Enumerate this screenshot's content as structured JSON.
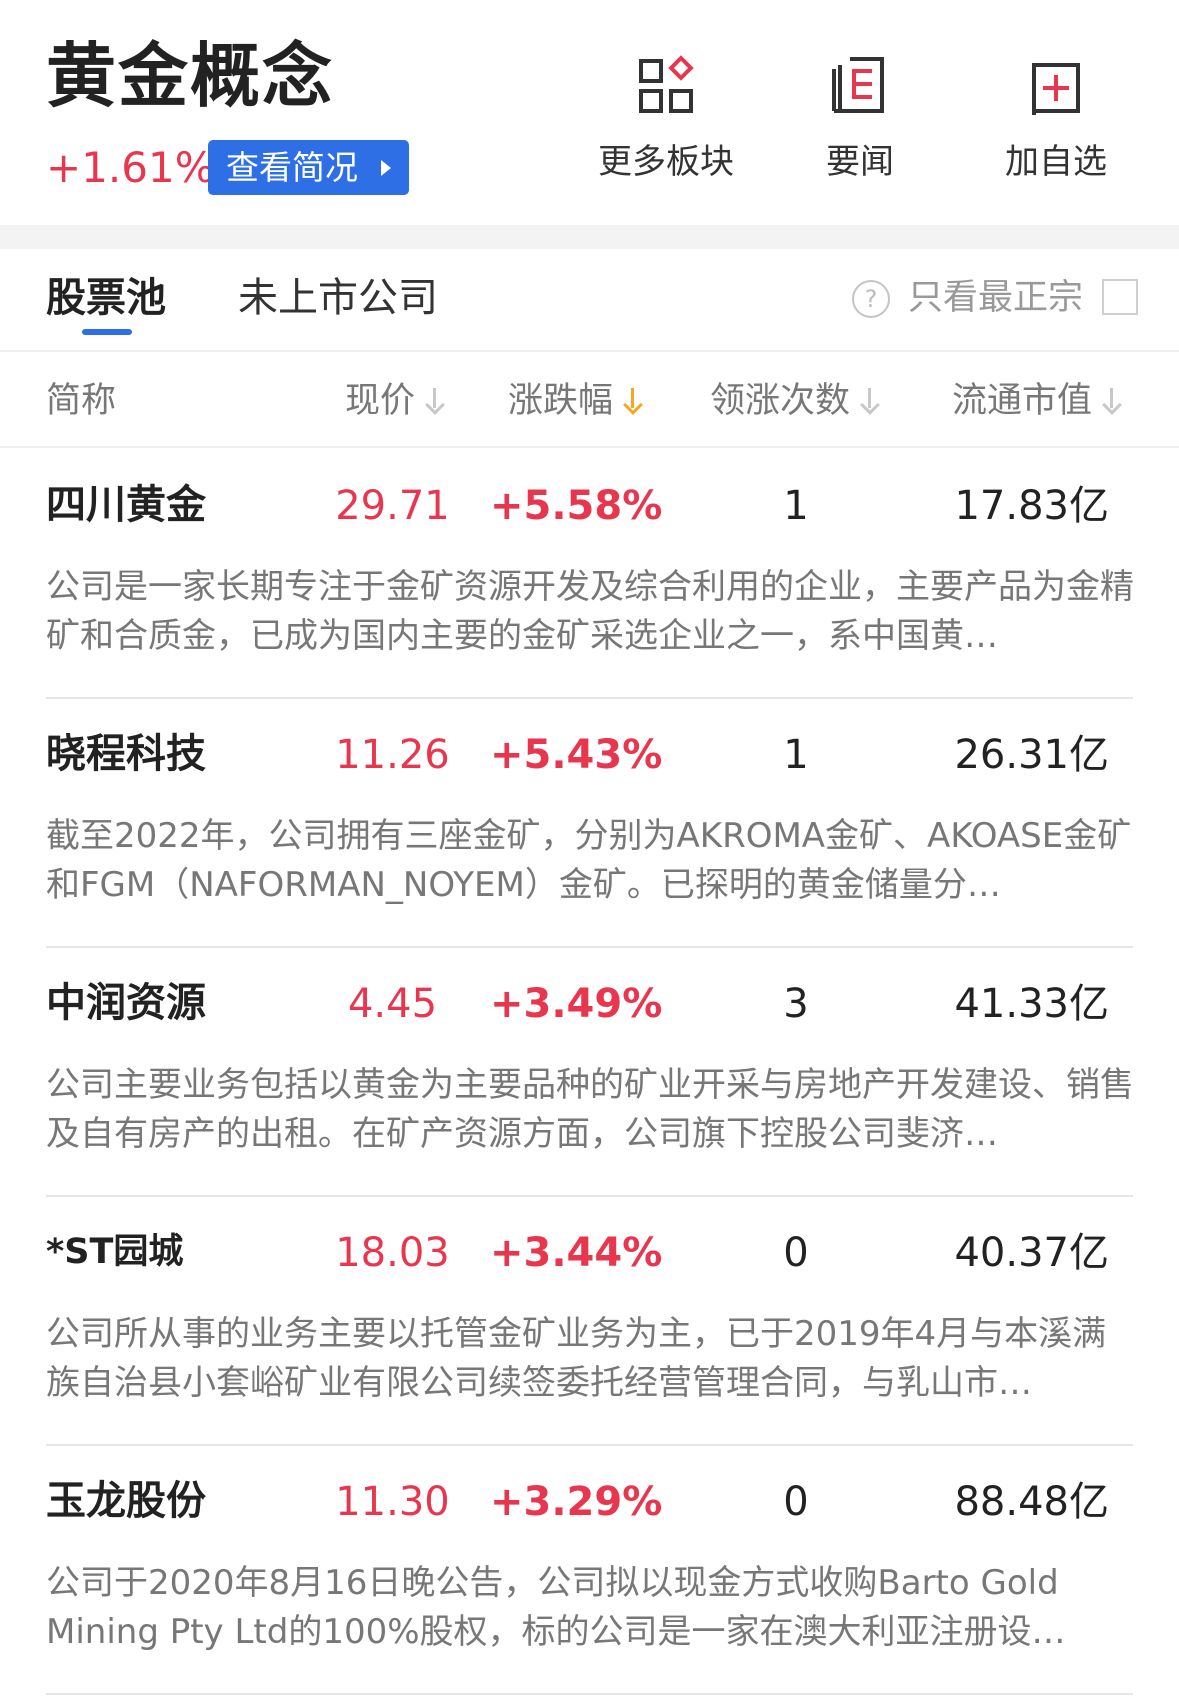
{
  "header": {
    "sector_name": "黄金概念",
    "sector_change": "+1.61%",
    "overview_button": "查看简况",
    "actions": [
      {
        "label": "更多板块",
        "icon": "grid-icon"
      },
      {
        "label": "要闻",
        "icon": "news-icon"
      },
      {
        "label": "加自选",
        "icon": "add-watchlist-icon"
      }
    ]
  },
  "tabs": {
    "stock_pool": "股票池",
    "unlisted": "未上市公司",
    "filter_label": "只看最正宗",
    "help_symbol": "?"
  },
  "columns": {
    "name": "简称",
    "price": "现价",
    "change": "涨跌幅",
    "lead_count": "领涨次数",
    "market_cap": "流通市值",
    "sorted_by": "涨跌幅"
  },
  "colors": {
    "up_red": "#e8364e",
    "accent_blue": "#2f6fe6",
    "sort_orange": "#f5a623"
  },
  "rows": [
    {
      "name": "四川黄金",
      "price": "29.71",
      "change": "+5.58%",
      "lead_count": "1",
      "market_cap": "17.83亿",
      "desc": "公司是一家长期专注于金矿资源开发及综合利用的企业，主要产品为金精矿和合质金，已成为国内主要的金矿采选企业之一，系中国黄…"
    },
    {
      "name": "晓程科技",
      "price": "11.26",
      "change": "+5.43%",
      "lead_count": "1",
      "market_cap": "26.31亿",
      "desc": "截至2022年，公司拥有三座金矿，分别为AKROMA金矿、AKOASE金矿和FGM（NAFORMAN_NOYEM）金矿。已探明的黄金储量分…"
    },
    {
      "name": "中润资源",
      "price": "4.45",
      "change": "+3.49%",
      "lead_count": "3",
      "market_cap": "41.33亿",
      "desc": "公司主要业务包括以黄金为主要品种的矿业开采与房地产开发建设、销售及自有房产的出租。在矿产资源方面，公司旗下控股公司斐济…"
    },
    {
      "name": "*ST园城",
      "price": "18.03",
      "change": "+3.44%",
      "lead_count": "0",
      "market_cap": "40.37亿",
      "desc": "公司所从事的业务主要以托管金矿业务为主，已于2019年4月与本溪满族自治县小套峪矿业有限公司续签委托经营管理合同，与乳山市…"
    },
    {
      "name": "玉龙股份",
      "price": "11.30",
      "change": "+3.29%",
      "lead_count": "0",
      "market_cap": "88.48亿",
      "desc": "公司于2020年8月16日晚公告，公司拟以现金方式收购Barto Gold Mining Pty Ltd的100%股权，标的公司是一家在澳大利亚注册设…"
    }
  ]
}
